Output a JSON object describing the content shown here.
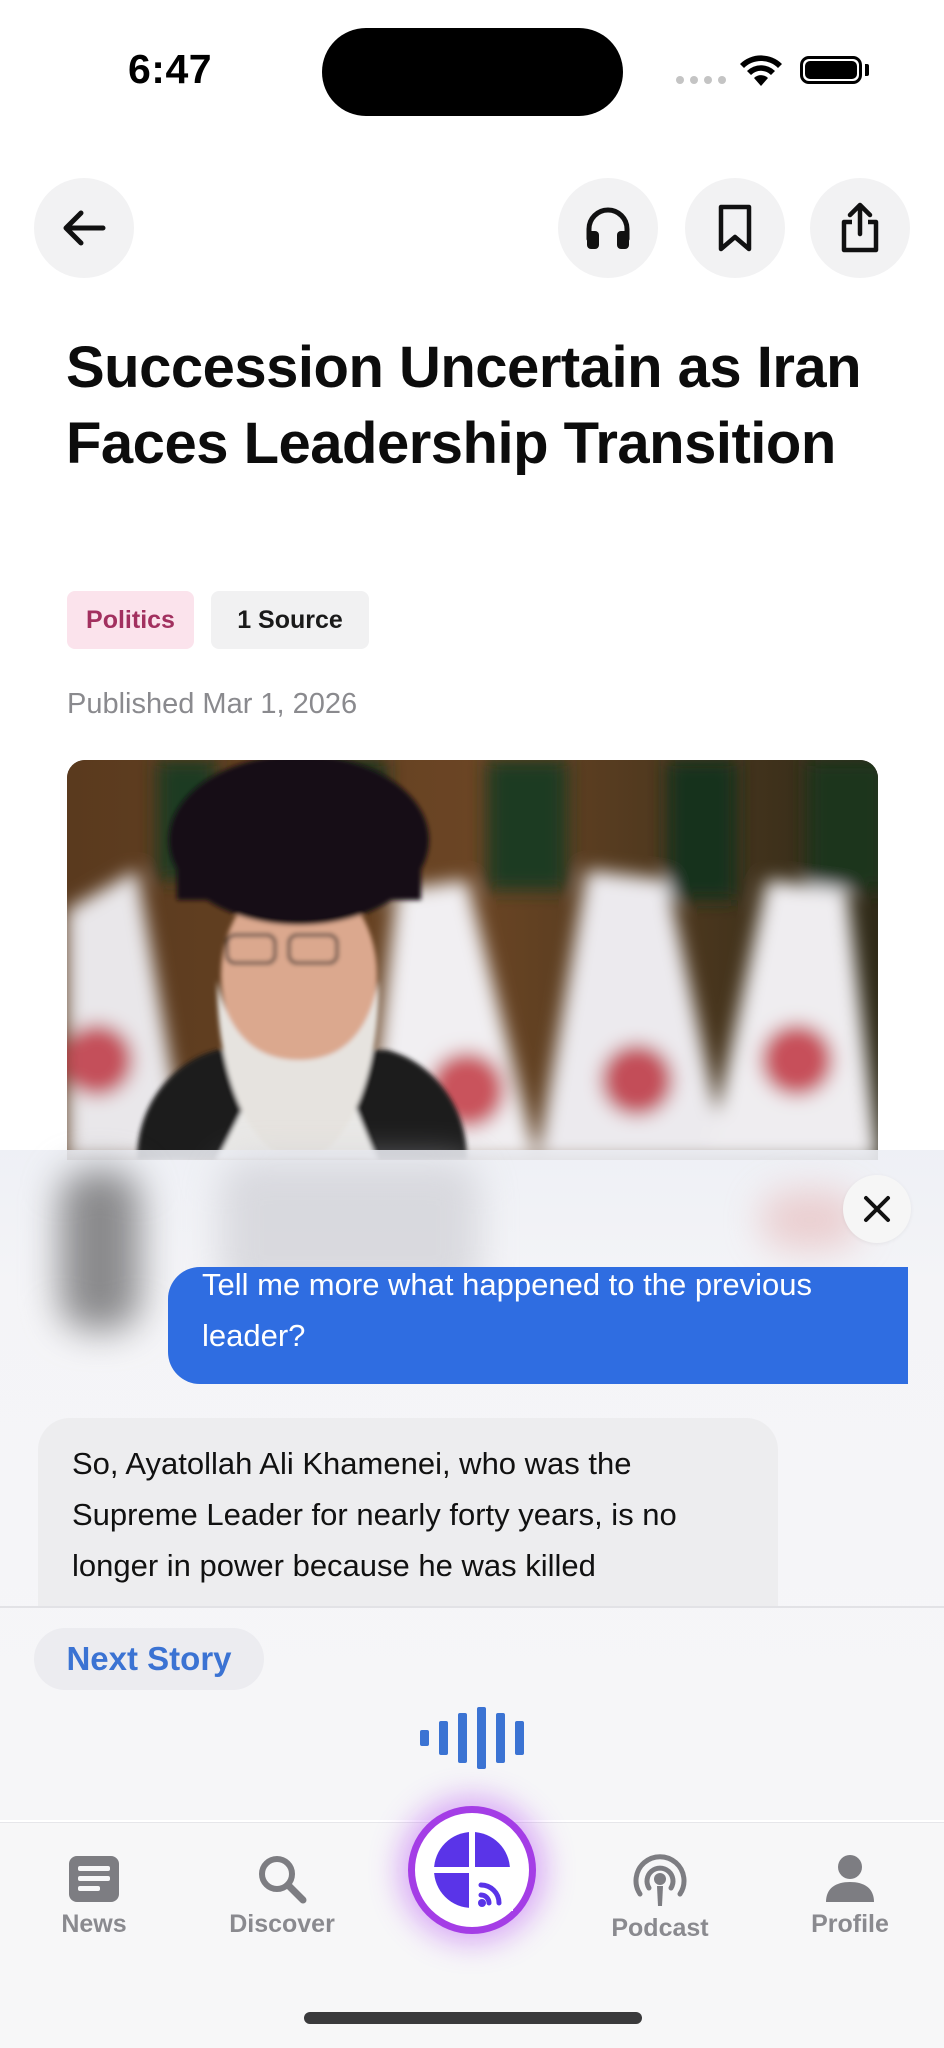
{
  "status_bar": {
    "time": "6:47"
  },
  "toolbar": {
    "back_icon": "arrow-left-icon",
    "listen_icon": "headphones-icon",
    "bookmark_icon": "bookmark-icon",
    "share_icon": "share-icon"
  },
  "article": {
    "title": "Succession Uncertain as Iran Faces Leadership Transition",
    "tags": [
      "Politics",
      "1 Source"
    ],
    "published": "Published Mar 1, 2026",
    "category_color": "#a2305f"
  },
  "conversation": {
    "user_message": "Tell me more what happened to the previous leader?",
    "assistant_message": "So, Ayatollah Ali Khamenei, who was the Supreme Leader for nearly forty years, is no longer in power because he was killed",
    "user_bubble_color": "#2f6de1",
    "next_story_label": "Next Story"
  },
  "tab_bar": {
    "items": [
      {
        "label": "News",
        "icon": "news-icon"
      },
      {
        "label": "Discover",
        "icon": "search-icon"
      },
      {
        "label": "",
        "icon": "ai-assistant-icon"
      },
      {
        "label": "Podcast",
        "icon": "podcast-icon"
      },
      {
        "label": "Profile",
        "icon": "profile-icon"
      }
    ],
    "accent_color": "#a43de6"
  }
}
